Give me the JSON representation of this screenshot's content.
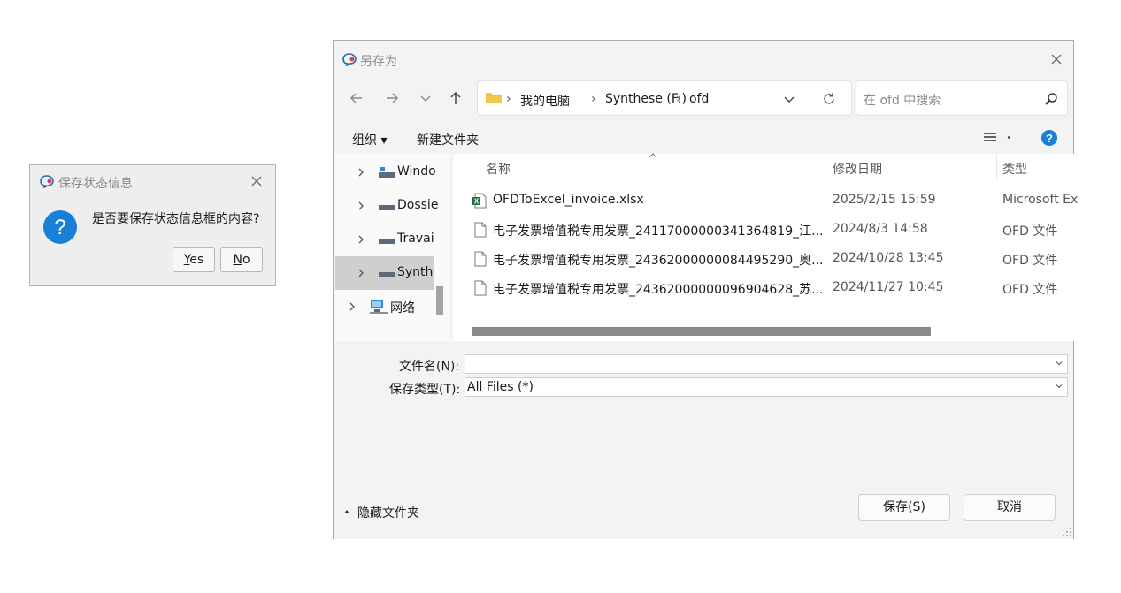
{
  "status_dialog": {
    "title": "保存状态信息",
    "message": "是否要保存状态信息框的内容?",
    "yes_label": "Yes",
    "no_label": "No"
  },
  "save_dialog": {
    "title": "另存为",
    "breadcrumb": [
      "我的电脑",
      "Synthese (F:)",
      "ofd"
    ],
    "search_placeholder": "在 ofd 中搜索",
    "toolbar": {
      "organize": "组织 ▾",
      "new_folder": "新建文件夹"
    },
    "nav_items": [
      {
        "label": "Windo"
      },
      {
        "label": "Dossie"
      },
      {
        "label": "Travai"
      },
      {
        "label": "Synth"
      },
      {
        "label": "网络"
      }
    ],
    "columns": {
      "name": "名称",
      "modified": "修改日期",
      "type": "类型"
    },
    "files": [
      {
        "name": "OFDToExcel_invoice.xlsx",
        "modified": "2025/2/15 15:59",
        "type": "Microsoft Ex",
        "icon": "excel-file-icon"
      },
      {
        "name": "电子发票增值税专用发票_24117000000341364819_江...",
        "modified": "2024/8/3 14:58",
        "type": "OFD 文件",
        "icon": "file-icon"
      },
      {
        "name": "电子发票增值税专用发票_24362000000084495290_奥...",
        "modified": "2024/10/28 13:45",
        "type": "OFD 文件",
        "icon": "file-icon"
      },
      {
        "name": "电子发票增值税专用发票_24362000000096904628_苏...",
        "modified": "2024/11/27 10:45",
        "type": "OFD 文件",
        "icon": "file-icon"
      }
    ],
    "filename_label": "文件名(N):",
    "filename_value": "",
    "filetype_label": "保存类型(T):",
    "filetype_value": "All Files (*)",
    "hide_folders": "隐藏文件夹",
    "save_button": "保存(S)",
    "cancel_button": "取消"
  },
  "colors": {
    "accent": "#1a7fd6",
    "selection": "#cfcfcf",
    "folder": "#f2c94c",
    "excel": "#1e7145"
  }
}
